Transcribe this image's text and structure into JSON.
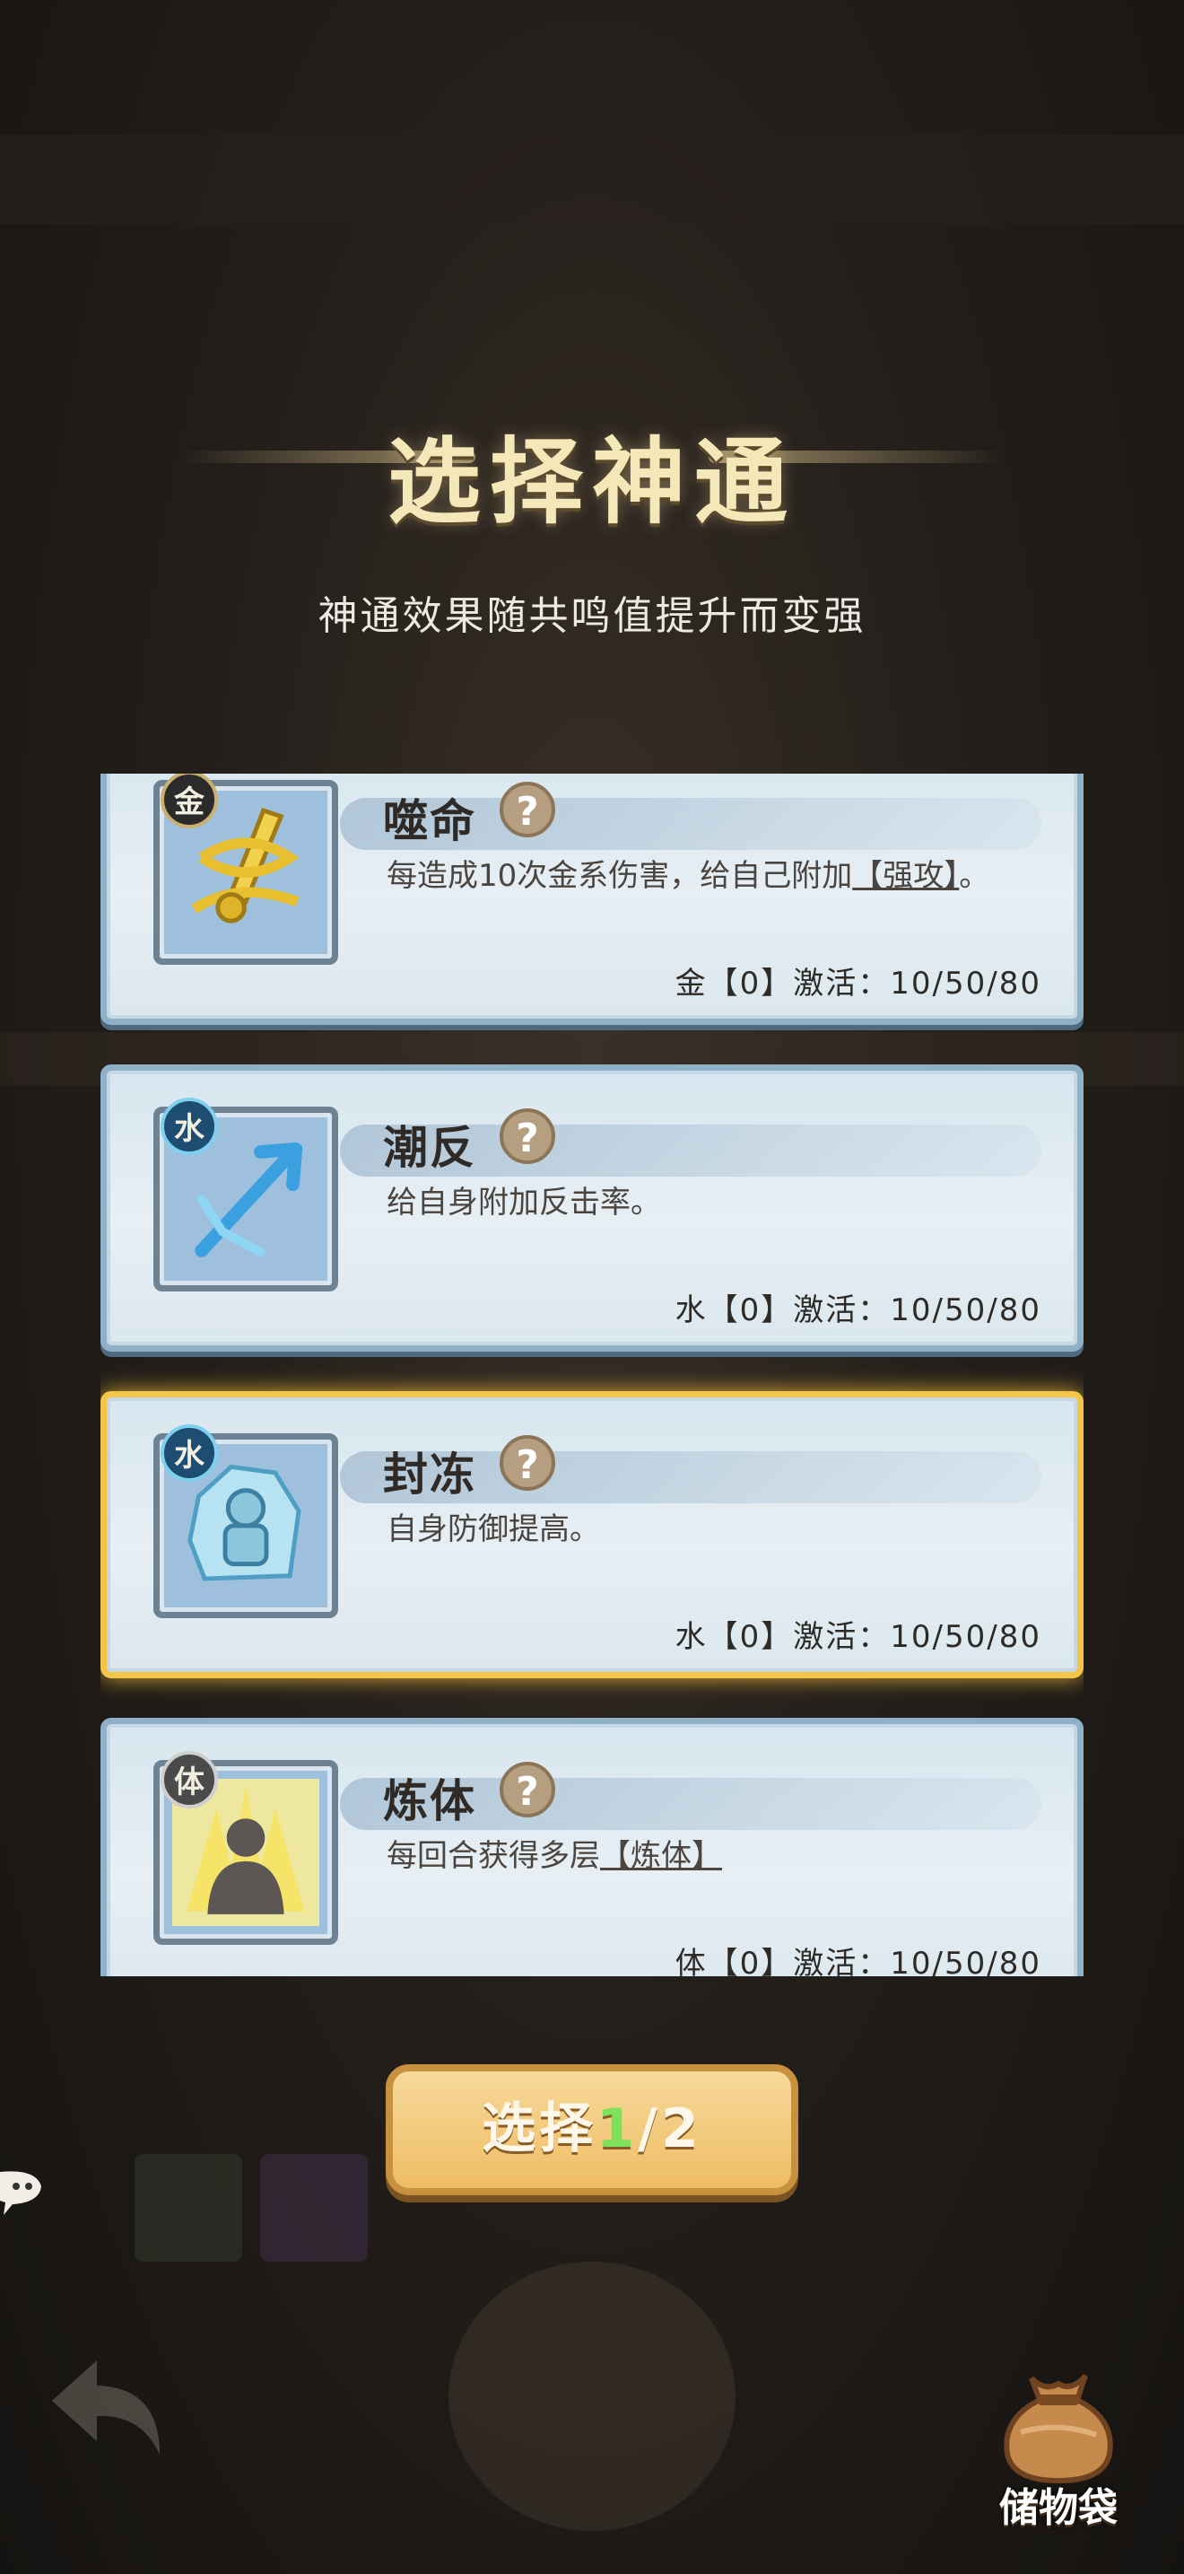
{
  "header": {
    "title": "选择神通",
    "subtitle": "神通效果随共鸣值提升而变强"
  },
  "skills": [
    {
      "name": "噬命",
      "element": "金",
      "icon": "golden-blade-icon",
      "description_prefix": "每造成10次金系伤害，给自己附加",
      "keyword": "【强攻】",
      "description_suffix": "。",
      "activation": "金【0】激活：10/50/80",
      "selected": false
    },
    {
      "name": "潮反",
      "element": "水",
      "icon": "water-arrow-icon",
      "description_prefix": "给自身附加反击率。",
      "keyword": "",
      "description_suffix": "",
      "activation": "水【0】激活：10/50/80",
      "selected": false
    },
    {
      "name": "封冻",
      "element": "水",
      "icon": "ice-statue-icon",
      "description_prefix": "自身防御提高。",
      "keyword": "",
      "description_suffix": "",
      "activation": "水【0】激活：10/50/80",
      "selected": true
    },
    {
      "name": "炼体",
      "element": "体",
      "icon": "body-training-icon",
      "description_prefix": "每回合获得多层",
      "keyword": "【炼体】",
      "description_suffix": "",
      "activation": "体【0】激活：10/50/80",
      "selected": false
    }
  ],
  "help_glyph": "?",
  "select_button": {
    "prefix": "选择",
    "current": "1",
    "total": "/2"
  },
  "inventory": {
    "label": "储物袋",
    "icon": "pouch-icon"
  },
  "colors": {
    "title_gold": "#f4e7b8",
    "selected_border": "#f3c64a",
    "card_border": "#8fb1c8",
    "button_gold": "#eebd64",
    "counter_green": "#7fe05a"
  }
}
